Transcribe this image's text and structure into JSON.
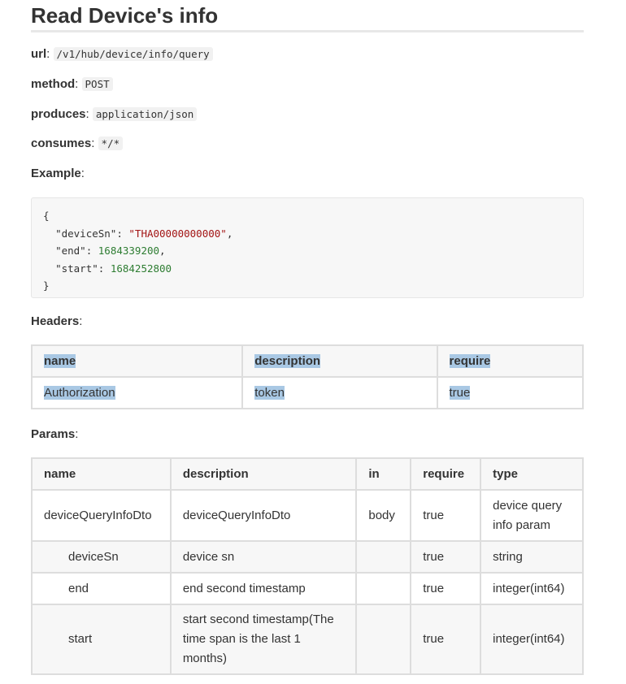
{
  "title": "Read Device's info",
  "meta": {
    "url_label": "url",
    "url_value": "/v1/hub/device/info/query",
    "method_label": "method",
    "method_value": "POST",
    "produces_label": "produces",
    "produces_value": "application/json",
    "consumes_label": "consumes",
    "consumes_value": "*/*",
    "example_label": "Example"
  },
  "example": {
    "open_brace": "{",
    "deviceSn_key": "\"deviceSn\"",
    "deviceSn_value": "\"THA00000000000\"",
    "end_key": "\"end\"",
    "end_value": "1684339200",
    "start_key": "\"start\"",
    "start_value": "1684252800",
    "close_brace": "}"
  },
  "headers": {
    "label": "Headers",
    "columns": [
      "name",
      "description",
      "require"
    ],
    "rows": [
      [
        "Authorization",
        "token",
        "true"
      ]
    ]
  },
  "params": {
    "label": "Params",
    "columns": [
      "name",
      "description",
      "in",
      "require",
      "type"
    ],
    "rows": [
      [
        "deviceQueryInfoDto",
        "deviceQueryInfoDto",
        "body",
        "true",
        "device query info param"
      ],
      [
        "deviceSn",
        "device sn",
        "",
        "true",
        "string"
      ],
      [
        "end",
        "end second timestamp",
        "",
        "true",
        "integer(int64)"
      ],
      [
        "start",
        "start second timestamp(The time span is the last 1 months)",
        "",
        "true",
        "integer(int64)"
      ]
    ]
  }
}
